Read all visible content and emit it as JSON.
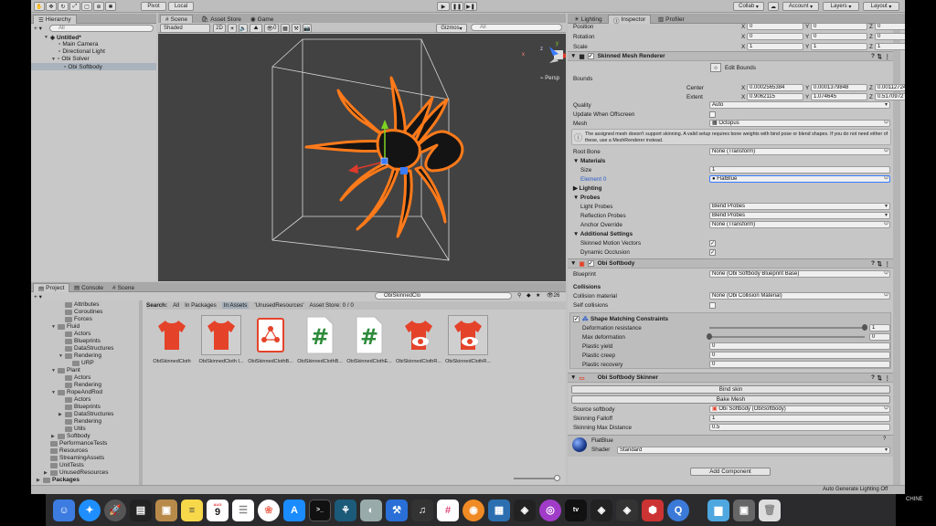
{
  "toolbar": {
    "pivot": "Pivot",
    "local": "Local",
    "collab": "Collab",
    "account": "Account",
    "layers": "Layers",
    "layout": "Layout"
  },
  "hierarchy": {
    "tab": "Hierarchy",
    "search_placeholder": "All",
    "scene_name": "Untitled*",
    "items": [
      "Main Camera",
      "Directional Light",
      "Obi Solver",
      "Obi Softbody"
    ]
  },
  "scene_tabs": [
    "Scene",
    "Asset Store",
    "Game"
  ],
  "scene_toolbar": {
    "shading": "Shaded",
    "mode": "2D",
    "gizmo_count": "0",
    "gizmos": "Gizmos",
    "search_placeholder": "All",
    "persp": "Persp",
    "axis_labels": [
      "y",
      "z",
      "x"
    ]
  },
  "project": {
    "tabs": [
      "Project",
      "Console",
      "Scene"
    ],
    "search_value": "ObiSkinnedClo",
    "count": "26",
    "filter_label": "Search:",
    "filters": [
      "All",
      "In Packages",
      "In Assets",
      "'UnusedResources'",
      "Asset Store: 0 / 0"
    ],
    "tree": [
      {
        "label": "Attributes",
        "indent": 2
      },
      {
        "label": "Coroutines",
        "indent": 2
      },
      {
        "label": "Forces",
        "indent": 2
      },
      {
        "label": "Fluid",
        "indent": 1,
        "open": true
      },
      {
        "label": "Actors",
        "indent": 2
      },
      {
        "label": "Blueprints",
        "indent": 2
      },
      {
        "label": "DataStructures",
        "indent": 2
      },
      {
        "label": "Rendering",
        "indent": 2,
        "open": true
      },
      {
        "label": "URP",
        "indent": 3
      },
      {
        "label": "Plant",
        "indent": 1,
        "open": true
      },
      {
        "label": "Actors",
        "indent": 2
      },
      {
        "label": "Rendering",
        "indent": 2
      },
      {
        "label": "RopeAndRod",
        "indent": 1,
        "open": true
      },
      {
        "label": "Actors",
        "indent": 2
      },
      {
        "label": "Blueprints",
        "indent": 2
      },
      {
        "label": "DataStructures",
        "indent": 2,
        "closed": true
      },
      {
        "label": "Rendering",
        "indent": 2
      },
      {
        "label": "Utils",
        "indent": 2
      },
      {
        "label": "Softbody",
        "indent": 1,
        "closed": true
      },
      {
        "label": "PerformanceTests",
        "indent": 0
      },
      {
        "label": "Resources",
        "indent": 0
      },
      {
        "label": "StreamingAssets",
        "indent": 0
      },
      {
        "label": "UnitTests",
        "indent": 0
      },
      {
        "label": "UnusedResources",
        "indent": 0,
        "closed": true
      },
      {
        "label": "Packages",
        "indent": -1,
        "closed": true,
        "bold": true
      }
    ],
    "assets": [
      {
        "label": "ObiSkinnedCloth",
        "icon": "shirt-icon"
      },
      {
        "label": "ObiSkinnedCloth I...",
        "icon": "shirt-icon"
      },
      {
        "label": "ObiSkinnedClothB...",
        "icon": "blueprint-icon"
      },
      {
        "label": "ObiSkinnedClothB...",
        "icon": "script-icon"
      },
      {
        "label": "ObiSkinnedClothE...",
        "icon": "script-icon"
      },
      {
        "label": "ObiSkinnedClothR...",
        "icon": "shirt-eye-icon"
      },
      {
        "label": "ObiSkinnedClothR...",
        "icon": "shirt-eye-icon"
      }
    ]
  },
  "inspector": {
    "tabs": [
      "Lighting",
      "Inspector",
      "Profiler"
    ],
    "transform": {
      "position_label": "Position",
      "rotation_label": "Rotation",
      "scale_label": "Scale",
      "position": [
        "0",
        "0",
        "0"
      ],
      "rotation": [
        "0",
        "0",
        "0"
      ],
      "scale": [
        "1",
        "1",
        "1"
      ]
    },
    "skinned_mesh_renderer": {
      "title": "Skinned Mesh Renderer",
      "edit_bounds": "Edit Bounds",
      "bounds_label": "Bounds",
      "center_label": "Center",
      "extent_label": "Extent",
      "center": [
        "0.0002565384",
        "0.0001379848",
        "0.001127243"
      ],
      "extent": [
        "0.9062115",
        "1.074645",
        "0.5170972"
      ],
      "quality_label": "Quality",
      "quality": "Auto",
      "update_offscreen_label": "Update When Offscreen",
      "mesh_label": "Mesh",
      "mesh": "Octopus",
      "warning": "The assigned mesh doesn't support skinning. A valid setup requires bone weights with bind pose or blend shapes. If you do not need either of these, use a MeshRenderer instead.",
      "root_bone_label": "Root Bone",
      "root_bone": "None (Transform)",
      "materials_label": "Materials",
      "size_label": "Size",
      "size": "1",
      "element0_label": "Element 0",
      "element0": "FlatBlue",
      "lighting_label": "Lighting",
      "probes_label": "Probes",
      "light_probes_label": "Light Probes",
      "light_probes": "Blend Probes",
      "reflection_probes_label": "Reflection Probes",
      "reflection_probes": "Blend Probes",
      "anchor_override_label": "Anchor Override",
      "anchor_override": "None (Transform)",
      "additional_label": "Additional Settings",
      "motion_vectors_label": "Skinned Motion Vectors",
      "dynamic_occlusion_label": "Dynamic Occlusion"
    },
    "obi_softbody": {
      "title": "Obi Softbody",
      "blueprint_label": "Blueprint",
      "blueprint": "None (Obi Softbody Blueprint Base)",
      "collisions_label": "Collisions",
      "collision_material_label": "Collision material",
      "collision_material": "None (Obi Collision Material)",
      "self_collisions_label": "Self collisions",
      "shape_matching_label": "Shape Matching Constraints",
      "deformation_resistance_label": "Deformation resistance",
      "deformation_resistance": "1",
      "deformation_resistance_level": 1.0,
      "max_deformation_label": "Max deformation",
      "max_deformation": "0",
      "max_deformation_level": 0.0,
      "plastic_yield_label": "Plastic yield",
      "plastic_yield": "0",
      "plastic_creep_label": "Plastic creep",
      "plastic_creep": "0",
      "plastic_recovery_label": "Plastic recovery",
      "plastic_recovery": "0"
    },
    "obi_skinner": {
      "title": "Obi Softbody Skinner",
      "bind_skin": "Bind skin",
      "bake_mesh": "Bake Mesh",
      "source_label": "Source softbody",
      "source": "Obi Softbody (ObiSoftbody)",
      "falloff_label": "Skinning Falloff",
      "falloff": "1",
      "max_distance_label": "Skinning Max Distance",
      "max_distance": "0.5"
    },
    "material": {
      "name": "FlatBlue",
      "shader_label": "Shader",
      "shader": "Standard"
    },
    "add_component": "Add Component"
  },
  "status_bar": {
    "text": "Auto Generate Lighting Off",
    "clipped_text": "CHINE"
  },
  "dock": {
    "calendar_day": "9",
    "calendar_month": "AUG",
    "terminal_glyph": ">_",
    "script_glyph": "#",
    "appletv_glyph": "tv"
  },
  "colors": {
    "selection_orange": "#ff7a1a",
    "obi_red": "#e4432a",
    "script_green": "#2e8b3a",
    "panel_bg": "#c8c8c8",
    "scene_bg": "#424242"
  }
}
